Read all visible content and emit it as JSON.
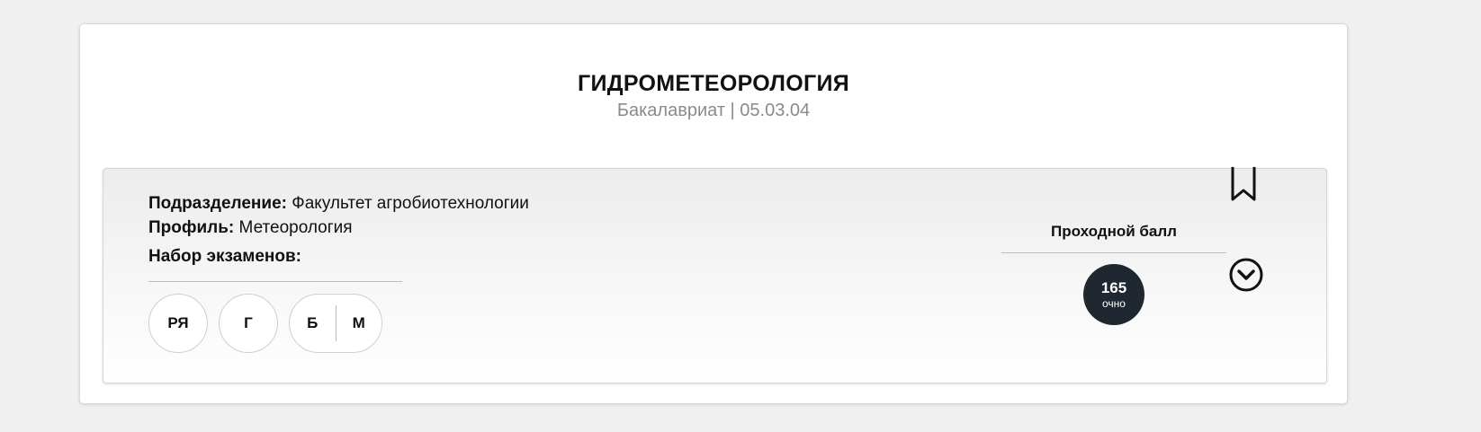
{
  "program": {
    "title": "ГИДРОМЕТЕОРОЛОГИЯ",
    "subtitle": "Бакалавриат | 05.03.04"
  },
  "details": {
    "division_label": "Подразделение:",
    "division_value": "Факультет агробиотехнологии",
    "profile_label": "Профиль:",
    "profile_value": "Метеорология",
    "exams_label": "Набор экзаменов:"
  },
  "exams": {
    "chip_1": "РЯ",
    "chip_2": "Г",
    "chip_3_left": "Б",
    "chip_3_right": "М"
  },
  "score": {
    "label": "Проходной балл",
    "value": "165",
    "mode": "очно"
  },
  "icons": {
    "bookmark": "bookmark-icon",
    "expand": "chevron-down-circle-icon"
  },
  "colors": {
    "badge": "#1f2730",
    "subtitle": "#8a8a8a"
  }
}
